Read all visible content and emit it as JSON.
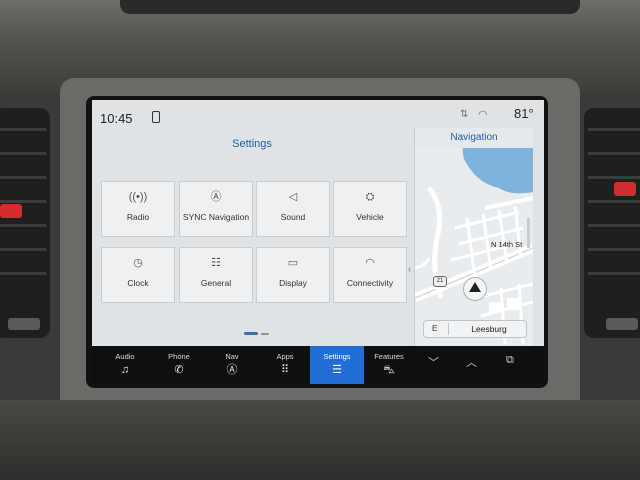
{
  "status": {
    "time": "10:45",
    "temperature": "81°"
  },
  "settings": {
    "title": "Settings",
    "tiles": [
      {
        "label": "Radio",
        "icon": "radio-icon"
      },
      {
        "label": "SYNC Navigation",
        "icon": "navigation-icon"
      },
      {
        "label": "Sound",
        "icon": "speaker-icon"
      },
      {
        "label": "Vehicle",
        "icon": "vehicle-icon"
      },
      {
        "label": "Clock",
        "icon": "clock-icon"
      },
      {
        "label": "General",
        "icon": "sliders-icon"
      },
      {
        "label": "Display",
        "icon": "display-icon"
      },
      {
        "label": "Connectivity",
        "icon": "wifi-icon"
      }
    ]
  },
  "navigation": {
    "title": "Navigation",
    "street": "N 14th St",
    "route_shield": "21",
    "destination_direction": "E",
    "destination": "Leesburg"
  },
  "bottom_bar": {
    "items": [
      {
        "label": "Audio",
        "icon": "music-note-icon"
      },
      {
        "label": "Phone",
        "icon": "phone-icon"
      },
      {
        "label": "Nav",
        "icon": "navigation-icon"
      },
      {
        "label": "Apps",
        "icon": "apps-grid-icon"
      },
      {
        "label": "Settings",
        "icon": "sliders-icon",
        "active": true
      },
      {
        "label": "Features",
        "icon": "car-icon"
      }
    ]
  },
  "colors": {
    "accent": "#1f6fd6",
    "title_blue": "#1d5fa8",
    "screen_bg": "#dfe3e6",
    "bar_bg": "#0e0f11"
  }
}
